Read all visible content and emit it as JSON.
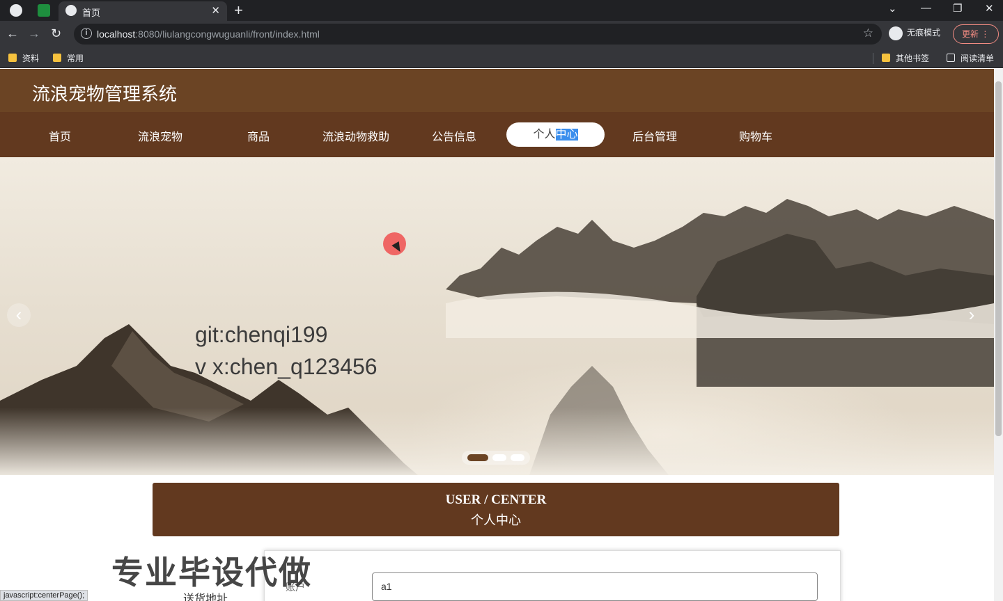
{
  "browser": {
    "tab_title": "首页",
    "url_host": "localhost",
    "url_rest": ":8080/liulangcongwuguanli/front/index.html",
    "incognito_label": "无痕模式",
    "update_label": "更新",
    "bookmarks": [
      "资料",
      "常用"
    ],
    "other_bookmarks": "其他书签",
    "reading_list": "阅读清单"
  },
  "site": {
    "title": "流浪宠物管理系统",
    "nav": [
      "首页",
      "流浪宠物",
      "商品",
      "流浪动物救助",
      "公告信息",
      "后台管理",
      "购物车"
    ],
    "nav_active_a": "个人",
    "nav_active_b": "中心"
  },
  "banner": {
    "line1": "git:chenqi199",
    "line2": "v x:chen_q123456",
    "slides": 3,
    "active_slide": 1
  },
  "user_center": {
    "title_en": "USER / CENTER",
    "title_cn": "个人中心"
  },
  "sidebar": {
    "address": "送货地址"
  },
  "watermark": "专业毕设代做",
  "form": {
    "account_label": "账户",
    "account_value": "a1"
  },
  "status_text": "javascript:centerPage();",
  "colors": {
    "header": "#6b4424",
    "nav": "#62391f",
    "accent": "#3a8eed"
  }
}
